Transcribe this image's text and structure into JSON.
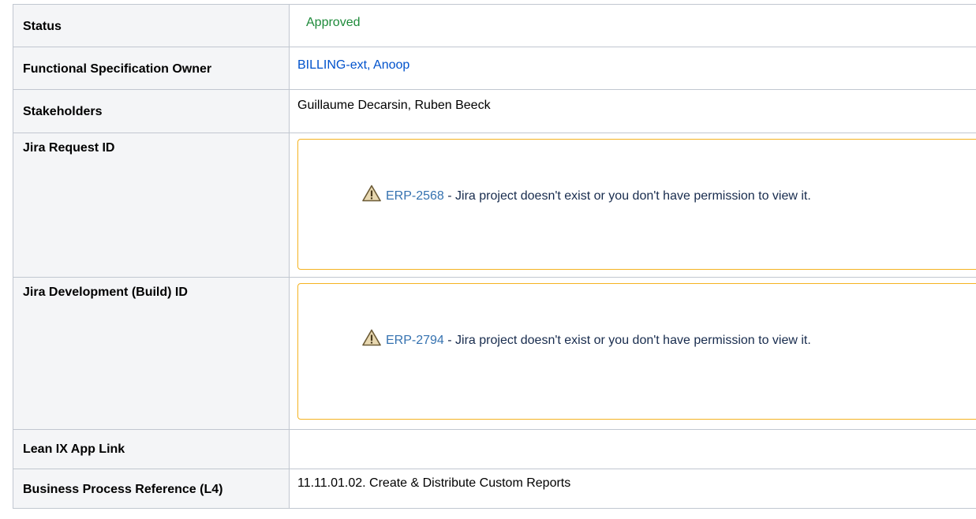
{
  "rows": [
    {
      "label": "Status",
      "value": "Approved"
    },
    {
      "label": "Functional Specification Owner",
      "value": "BILLING-ext, Anoop"
    },
    {
      "label": "Stakeholders",
      "value": "Guillaume Decarsin, Ruben Beeck"
    },
    {
      "label": "Jira Request ID",
      "jira_key": "ERP-2568",
      "jira_message": " - Jira project doesn't exist or you don't have permission to view it."
    },
    {
      "label": "Jira Development (Build) ID",
      "jira_key": "ERP-2794",
      "jira_message": " - Jira project doesn't exist or you don't have permission to view it."
    },
    {
      "label": "Lean IX App Link",
      "value": ""
    },
    {
      "label": "Business Process Reference (L4)",
      "value": "11.11.01.02. Create & Distribute Custom Reports"
    }
  ],
  "colors": {
    "status": "#1e8a3a",
    "link": "#0052cc",
    "jira_border": "#f5b321",
    "header_bg": "#f4f5f7"
  },
  "icons": {
    "warning": "warning-icon"
  }
}
